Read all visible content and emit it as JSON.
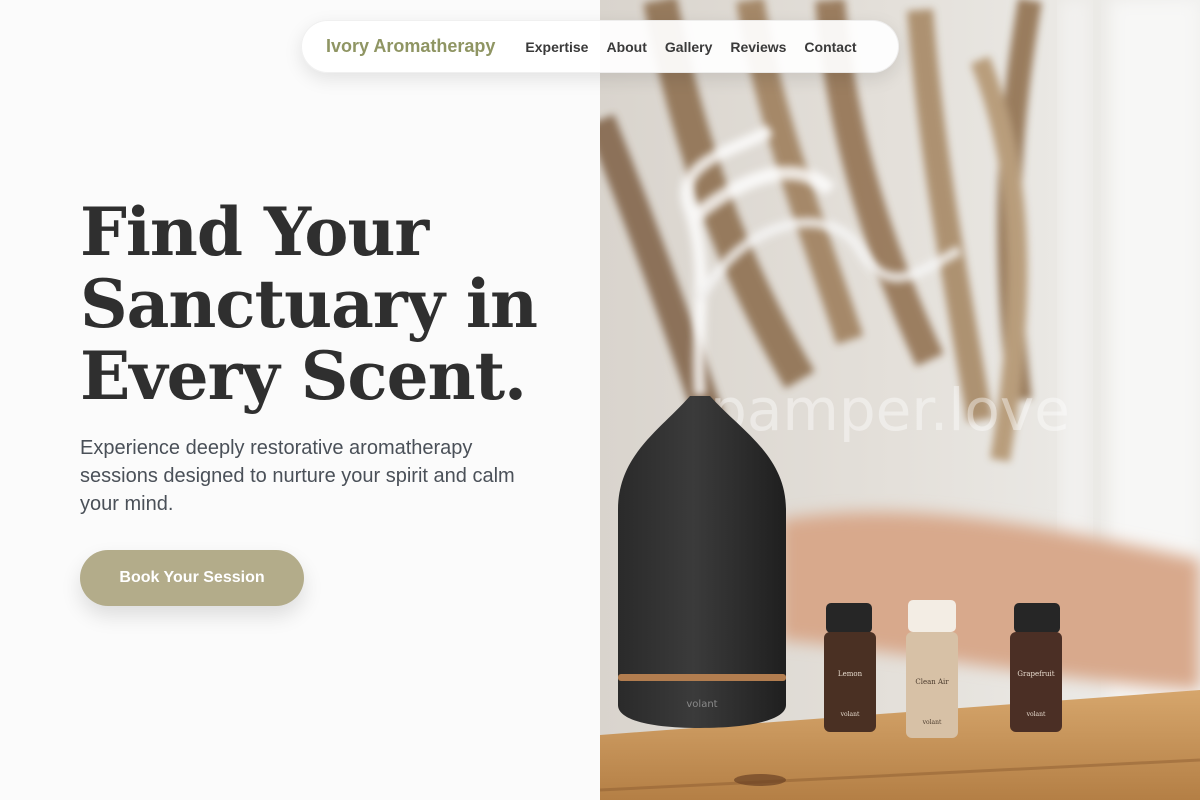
{
  "nav": {
    "brand": "Ivory Aromatherapy",
    "links": [
      "Expertise",
      "About",
      "Gallery",
      "Reviews",
      "Contact"
    ]
  },
  "hero": {
    "headline_lines": [
      "Find Your",
      "Sanctuary in",
      "Every Scent."
    ],
    "subtext": "Experience deeply restorative aromatherapy sessions designed to nurture your spirit and calm your mind.",
    "cta_label": "Book Your Session"
  },
  "photo": {
    "watermark": "pamper.love",
    "diffuser_label": "volant",
    "bottles": [
      {
        "name": "Lemon",
        "maker": "volant"
      },
      {
        "name": "Clean Air",
        "maker": "volant"
      },
      {
        "name": "Grapefruit",
        "maker": "volant"
      }
    ]
  },
  "colors": {
    "brand": "#8f9563",
    "cta_background": "#b3ac8a",
    "headline": "#2f2f2f",
    "body_text": "#4a5058"
  }
}
